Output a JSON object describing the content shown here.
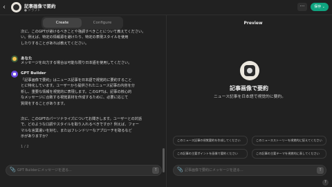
{
  "header": {
    "back_icon": "chevron-left-icon",
    "gpt_name": "記事画像で要約",
    "status": "● ドラフト",
    "more_label": "···",
    "save_label": "保存 ⌄",
    "accent": "#10a37f"
  },
  "tabs": [
    {
      "label": "Create",
      "active": true
    },
    {
      "label": "Configure",
      "active": false
    }
  ],
  "chat": {
    "intro_lines": [
      "次に、このGPTが避けるべきことや強調すべきことについて教えてください。",
      "い。例えば、特定の情報源を避けたり、特定の表現スタイルを使用",
      "したりすることがあれば教えてください。"
    ],
    "user_name": "あなた",
    "user_message": "メッセージを出力する場合は可能な限り日本語を使用してください。",
    "gpt_name": "GPT Builder",
    "gpt_para1": [
      "「記事画像で要約」はニュース記事を日本語で視覚的に要約すること",
      "とに特化しています。ユーザーから提供されたニュース記事の内容を分",
      "析し、重要な情報を視覚的に表現します。このGPTは、記事の核心的",
      "なメッセージに合致する視覚素材を作成するために、必要に応じて",
      "質問をすることがあります。"
    ],
    "gpt_para2": [
      "次に、このGPTのパーソナライズについてお聞きします。ユーザーとの対話",
      "で、どのような口調やスタイルを取り入れるべきですか？例えば、フォー",
      "マルな言葉遣いを好む、またはフレンドリーなアプローチを取るなど",
      "示がありますか？"
    ],
    "gpt_tail": "1 / 2",
    "input_placeholder": "GPT Builderにメッセージを送る..."
  },
  "preview": {
    "title": "Preview",
    "name": "記事画像で要約",
    "description": "ニュース記事を日本語で視覚的に要約。",
    "starters": [
      "このニュース記事の視覚要約を作成してください",
      "このニュースストーリーを視覚的に捉えてください",
      "この記事の主要ポイントを画像で要約ください",
      "この記事の主要テーマを視覚的に表してください"
    ],
    "input_placeholder": "記事画像で要約にメッセージを送る..."
  },
  "help_label": "?"
}
